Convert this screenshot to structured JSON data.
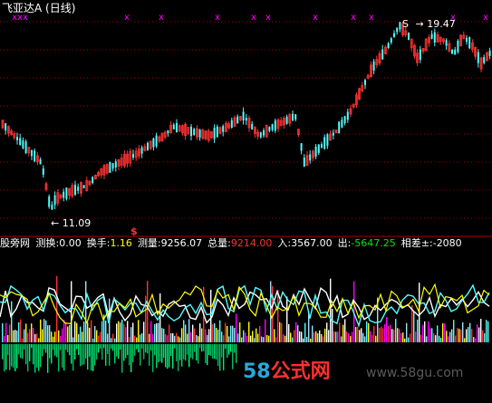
{
  "window": {
    "title": "飞亚达A",
    "period": "(日线)"
  },
  "colors": {
    "up": "#ff3232",
    "down": "#54fcfc",
    "grid": "#a00000",
    "marker": "#ff00ff",
    "white": "#ffffff",
    "yellow": "#ffff00",
    "green": "#00e600"
  },
  "main_chart": {
    "high_label": "19.47",
    "low_label": "11.09",
    "s_marker": "S",
    "dollar_marker": "$",
    "x_markers": [
      "xxx",
      "x",
      "x",
      "x",
      "x",
      "x",
      "x",
      "x",
      "x",
      "x",
      "x"
    ]
  },
  "indicator": {
    "name": "股旁网",
    "fields": [
      {
        "label": "测换:",
        "value": "0.00",
        "color": "#ffffff"
      },
      {
        "label": "换手:",
        "value": "1.16",
        "color": "#ffff00"
      },
      {
        "label": "测量:",
        "value": "9256.07",
        "color": "#ffffff"
      },
      {
        "label": "总量:",
        "value": "9214.00",
        "color": "#ff3232"
      },
      {
        "label": "入:",
        "value": "3567.00",
        "color": "#ffffff"
      },
      {
        "label": "出:",
        "value": "-5647.25",
        "color": "#00e600"
      },
      {
        "label": "相差±:",
        "value": "-2080",
        "color": "#ffffff"
      }
    ]
  },
  "watermark": {
    "num": "58",
    "text": "公式网",
    "url": "www.58gu.com"
  },
  "chart_data": {
    "type": "candlestick",
    "title": "飞亚达A (日线)",
    "annotations": [
      "19.47",
      "11.09"
    ],
    "price_range": [
      11.09,
      19.47
    ],
    "high_value": 19.47,
    "low_value": 11.09
  }
}
